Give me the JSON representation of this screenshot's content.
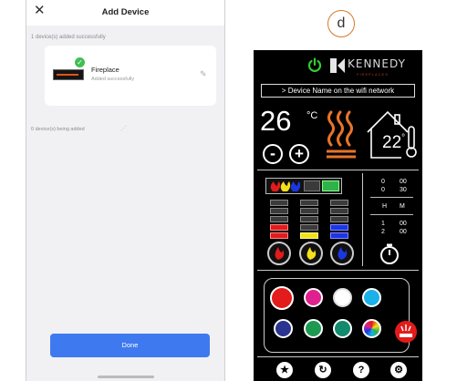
{
  "left_screen": {
    "title": "Add Device",
    "close_icon": "close-icon",
    "success_text": "1 device(s) added successfully",
    "device": {
      "name": "Fireplace",
      "status": "Added successfully",
      "icons": [
        "fireplace-thumbnail",
        "check-badge-icon",
        "edit-pencil-icon"
      ]
    },
    "being_added_text": "0 device(s) being added",
    "done_label": "Done",
    "colors": {
      "accent": "#3f79ef",
      "success": "#3fbf55",
      "background": "#f1f1f4"
    }
  },
  "figure_label": "d",
  "right_screen": {
    "brand": {
      "name": "KENNEDY",
      "sub": "FIREPLACES"
    },
    "wifi_label": "> Device Name on the wifi network",
    "set_temp": "26",
    "set_temp_unit": "°C",
    "room_temp": "22",
    "room_temp_unit": "°",
    "minus_label": "-",
    "plus_label": "+",
    "flame_levels": {
      "red": 2,
      "yellow": 1,
      "blue": 2,
      "total": 5
    },
    "timer": {
      "row1": [
        "0",
        "00"
      ],
      "row2": [
        "0",
        "30"
      ],
      "header": [
        "H",
        "M"
      ],
      "row3": [
        "1",
        "00"
      ],
      "row4": [
        "2",
        "00"
      ]
    },
    "color_swatches": [
      "#e31b1b",
      "#e0208f",
      "#ffffff",
      "#1ab0e8",
      "#2a3590",
      "#1e9a50",
      "#128a6e",
      "rainbow"
    ],
    "bottom_icons": [
      "favorite-star-icon",
      "refresh-icon",
      "help-icon",
      "settings-gear-icon"
    ],
    "colors": {
      "power": "#33cc33",
      "brand_red": "#c0392b",
      "heat": "#e8742a",
      "light_red": "#e31b1b"
    }
  }
}
